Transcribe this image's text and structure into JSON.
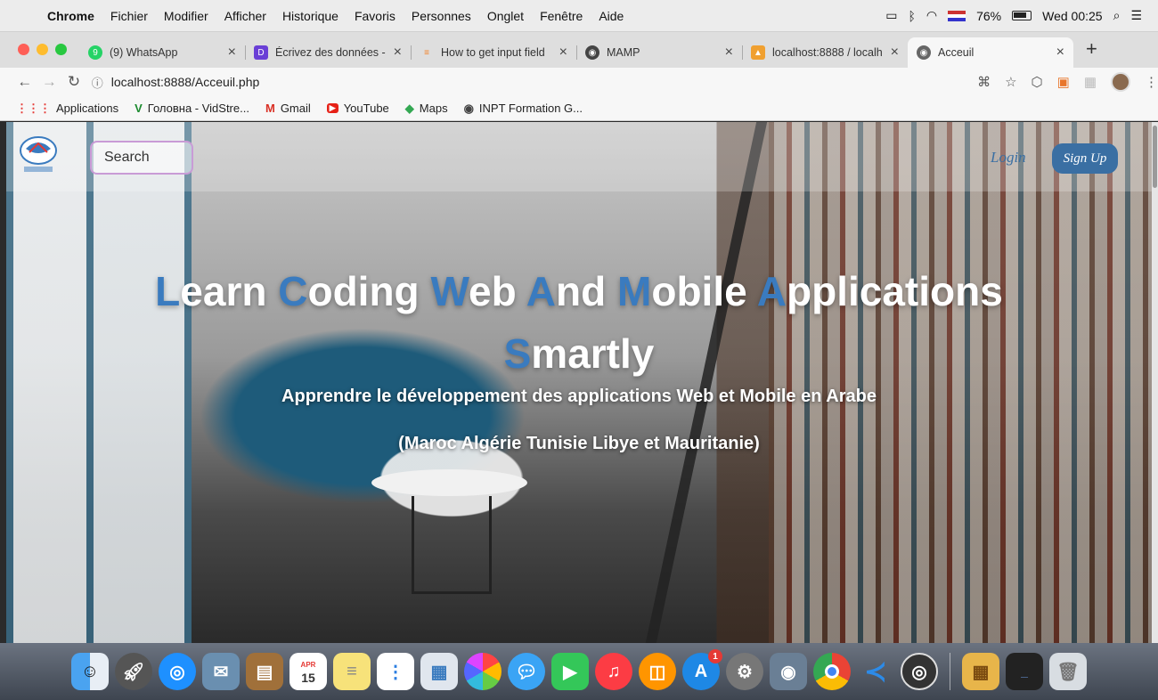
{
  "menubar": {
    "app": "Chrome",
    "items": [
      "Fichier",
      "Modifier",
      "Afficher",
      "Historique",
      "Favoris",
      "Personnes",
      "Onglet",
      "Fenêtre",
      "Aide"
    ],
    "battery": "76%",
    "clock": "Wed 00:25"
  },
  "tabs": [
    {
      "title": "(9) WhatsApp",
      "icon": "whatsapp-icon",
      "color": "#25d366"
    },
    {
      "title": "Écrivez des données -",
      "icon": "doc-icon",
      "color": "#6a3fd6"
    },
    {
      "title": "How to get input field",
      "icon": "stackoverflow-icon",
      "color": "#f48024"
    },
    {
      "title": "MAMP",
      "icon": "globe-icon",
      "color": "#444444"
    },
    {
      "title": "localhost:8888 / localh",
      "icon": "phpmyadmin-icon",
      "color": "#f0a030"
    },
    {
      "title": "Acceuil",
      "icon": "globe-icon",
      "color": "#444444",
      "active": true
    }
  ],
  "toolbar": {
    "url": "localhost:8888/Acceuil.php"
  },
  "bookmarks": [
    {
      "label": "Applications",
      "icon": "apps-grid-icon"
    },
    {
      "label": "Головна - VidStre...",
      "icon": "vidstreaming-icon"
    },
    {
      "label": "Gmail",
      "icon": "gmail-icon"
    },
    {
      "label": "YouTube",
      "icon": "youtube-icon"
    },
    {
      "label": "Maps",
      "icon": "maps-icon"
    },
    {
      "label": "INPT Formation G...",
      "icon": "globe-icon"
    }
  ],
  "page": {
    "search_placeholder": "Search",
    "login": "Login",
    "signup": "Sign Up",
    "headline_line1": [
      {
        "cap": "L",
        "rest": "earn"
      },
      {
        "cap": "C",
        "rest": "oding"
      },
      {
        "cap": "W",
        "rest": "eb"
      },
      {
        "cap": "A",
        "rest": "nd"
      },
      {
        "cap": "M",
        "rest": "obile"
      },
      {
        "cap": "A",
        "rest": "pplications"
      }
    ],
    "headline_line2": {
      "cap": "S",
      "rest": "martly"
    },
    "subtitle": "Apprendre le développement des applications Web et Mobile en Arabe",
    "countries": "(Maroc Algérie Tunisie Libye et Mauritanie)",
    "accent_color": "#3a7bbf"
  },
  "dock": {
    "calendar_month": "APR",
    "calendar_day": "15",
    "appstore_badge": "1"
  }
}
